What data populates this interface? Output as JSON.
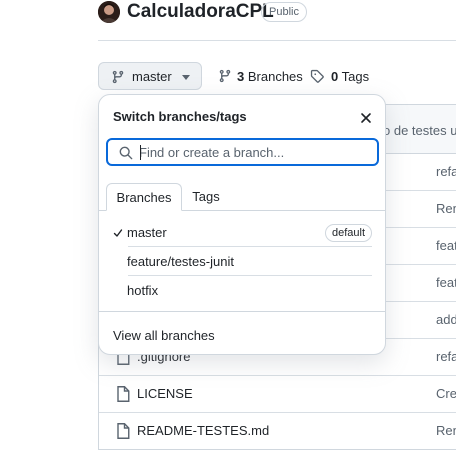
{
  "repo": {
    "name": "CalculadoraCPL",
    "visibility": "Public"
  },
  "toolbar": {
    "branch_button_label": "master",
    "branches_count": "3",
    "branches_label": "Branches",
    "tags_count": "0",
    "tags_label": "Tags"
  },
  "file_list": {
    "header_message": "o de testes ur",
    "rows": [
      {
        "name": "",
        "message": "refa"
      },
      {
        "name": "",
        "message": "Ren"
      },
      {
        "name": "",
        "message": "feat"
      },
      {
        "name": "",
        "message": "feat"
      },
      {
        "name": "",
        "message": "add"
      },
      {
        "name": ".gitignore",
        "message": "refa"
      },
      {
        "name": "LICENSE",
        "message": "Crea"
      },
      {
        "name": "README-TESTES.md",
        "message": "Ren"
      }
    ]
  },
  "dropdown": {
    "title": "Switch branches/tags",
    "search_placeholder": "Find or create a branch...",
    "search_value": "",
    "tabs": [
      {
        "label": "Branches",
        "active": true
      },
      {
        "label": "Tags",
        "active": false
      }
    ],
    "branches": [
      {
        "name": "master",
        "selected": true,
        "badge": "default"
      },
      {
        "name": "feature/testes-junit",
        "selected": false,
        "badge": ""
      },
      {
        "name": "hotfix",
        "selected": false,
        "badge": ""
      }
    ],
    "view_all_label": "View all branches"
  },
  "colors": {
    "accent": "#0969da",
    "border": "#d0d7de",
    "muted_text": "#59636e"
  },
  "icons": {
    "branch": "git-branch-icon",
    "tag": "tag-icon",
    "search": "search-icon",
    "close": "close-icon",
    "check": "check-icon",
    "file": "file-icon"
  }
}
